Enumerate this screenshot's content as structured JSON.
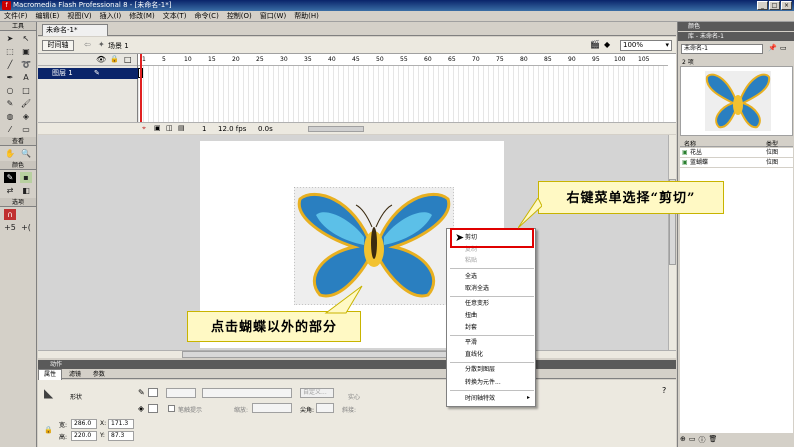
{
  "window": {
    "title": "Macromedia Flash Professional 8 - [未命名-1*]",
    "controls": [
      "_",
      "□",
      "×"
    ]
  },
  "menu": [
    "文件(F)",
    "编辑(E)",
    "视图(V)",
    "插入(I)",
    "修改(M)",
    "文本(T)",
    "命令(C)",
    "控制(O)",
    "窗口(W)",
    "帮助(H)"
  ],
  "toolbox": {
    "tools_label": "工具",
    "view_label": "查看",
    "colors_label": "颜色",
    "options_label": "选项"
  },
  "document": {
    "tab": "未命名-1*",
    "timeline_button": "时间轴",
    "scene": "场景 1",
    "zoom": "100%"
  },
  "timeline": {
    "layer_name": "图层 1",
    "frame_numbers": [
      "1",
      "5",
      "10",
      "15",
      "20",
      "25",
      "30",
      "35",
      "40",
      "45",
      "50",
      "55",
      "60",
      "65",
      "70",
      "75",
      "80",
      "85",
      "90",
      "95",
      "100",
      "105"
    ],
    "current_frame": "1",
    "fps": "12.0 fps",
    "time": "0.0s"
  },
  "context_menu": {
    "items": [
      "剪切",
      "复制",
      "粘贴",
      "全选",
      "取消全选",
      "任意变形",
      "扭曲",
      "封套",
      "平滑",
      "直线化",
      "分散到图层",
      "转换为元件...",
      "时间轴特效"
    ],
    "disabled": [
      "复制",
      "粘贴"
    ],
    "highlight_color": "#e00000"
  },
  "callouts": {
    "right": "右键菜单选择“剪切”",
    "left": "点击蝴蝶以外的部分"
  },
  "bottom": {
    "actions_label": "动作",
    "tabs": [
      "属性",
      "滤镜",
      "参数"
    ],
    "shape_label": "形状",
    "width_label": "宽:",
    "width": "286.0",
    "height_label": "高:",
    "height": "220.0",
    "x_label": "X:",
    "x": "171.3",
    "y_label": "Y:",
    "y": "87.3",
    "custom_button": "自定义...",
    "stroke_hint": "笔触提示",
    "scale_label": "缩放:",
    "tip_label": "尖角:",
    "solid_label": "实心",
    "miter_label": "斜接:"
  },
  "right_panel": {
    "colors_head": "颜色",
    "library_head": "库 - 未命名-1",
    "library_doc": "未命名-1",
    "items_count": "2 项",
    "col_name": "名称",
    "col_type": "类型",
    "items": [
      {
        "name": "花丛",
        "type": "位图"
      },
      {
        "name": "蓝蝴蝶",
        "type": "位图"
      }
    ]
  }
}
